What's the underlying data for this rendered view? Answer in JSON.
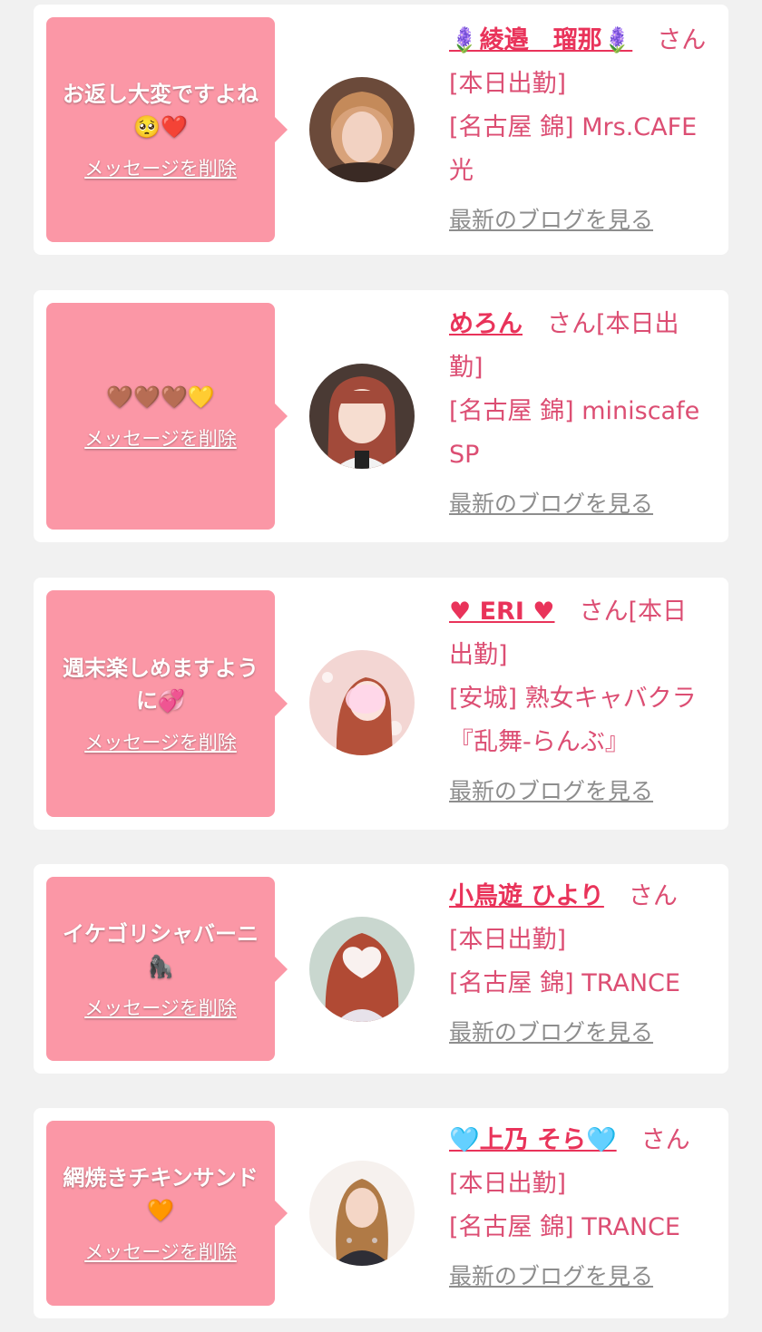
{
  "colors": {
    "page_bg": "#f1f1f1",
    "card_bg": "#ffffff",
    "bubble_bg": "#fb97a6",
    "name_accent": "#e9335a",
    "info_text": "#dc4e73",
    "blog_link": "#8d8d8d"
  },
  "cards": [
    {
      "message": "お返し大変ですよね🥺❤️",
      "delete_label": "メッセージを削除",
      "name": "🪻綾邉　瑠那🪻",
      "san": "さん",
      "status": "[本日出勤]",
      "shop": "[名古屋 錦] Mrs.CAFE光",
      "blog_label": "最新のブログを見る",
      "avatar_icon": "profile-photo"
    },
    {
      "message": "🤎🤎🤎💛",
      "delete_label": "メッセージを削除",
      "name": "めろん",
      "san": "さん",
      "status": "[本日出勤]",
      "shop": "[名古屋 錦] miniscafe SP",
      "blog_label": "最新のブログを見る",
      "avatar_icon": "profile-photo"
    },
    {
      "message": "週末楽しめますように💞",
      "delete_label": "メッセージを削除",
      "name": "♥ ERI ♥",
      "san": "さん",
      "status": "[本日出勤]",
      "shop": "[安城] 熟女キャバクラ『乱舞-らんぶ』",
      "blog_label": "最新のブログを見る",
      "avatar_icon": "profile-photo"
    },
    {
      "message": "イケゴリシャバーニ🦍",
      "delete_label": "メッセージを削除",
      "name": "小鳥遊 ひより",
      "san": "さん",
      "status": "[本日出勤]",
      "shop": "[名古屋 錦] TRANCE",
      "blog_label": "最新のブログを見る",
      "avatar_icon": "profile-photo"
    },
    {
      "message": "網焼きチキンサンド🧡",
      "delete_label": "メッセージを削除",
      "name": "🩵上乃 そら🩵",
      "san": "さん",
      "status": "[本日出勤]",
      "shop": "[名古屋 錦] TRANCE",
      "blog_label": "最新のブログを見る",
      "avatar_icon": "profile-photo"
    }
  ]
}
